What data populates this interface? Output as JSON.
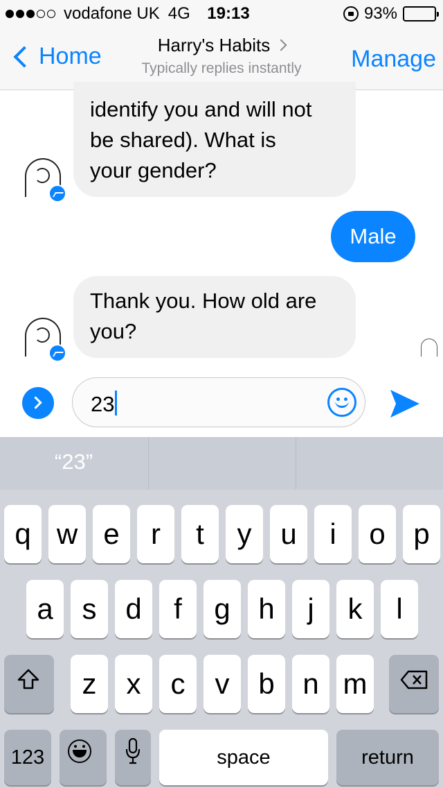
{
  "status_bar": {
    "carrier": "vodafone UK",
    "network": "4G",
    "time": "19:13",
    "battery": "93%",
    "battery_level": 0.93,
    "signal_bars_filled": 3,
    "signal_bars_total": 5
  },
  "nav": {
    "back_label": "Home",
    "title": "Harry's Habits",
    "subtitle": "Typically replies instantly",
    "manage_label": "Manage"
  },
  "messages": [
    {
      "from": "bot",
      "lines": [
        "identify you and will not",
        "be shared). What is",
        "your gender?"
      ]
    },
    {
      "from": "user",
      "text": "Male"
    },
    {
      "from": "bot",
      "lines": [
        "Thank you. How old are",
        "you?"
      ]
    }
  ],
  "composer": {
    "value": "23"
  },
  "keyboard": {
    "suggestions": [
      "“23”",
      "",
      ""
    ],
    "row1": [
      "q",
      "w",
      "e",
      "r",
      "t",
      "y",
      "u",
      "i",
      "o",
      "p"
    ],
    "row2": [
      "a",
      "s",
      "d",
      "f",
      "g",
      "h",
      "j",
      "k",
      "l"
    ],
    "row3": [
      "z",
      "x",
      "c",
      "v",
      "b",
      "n",
      "m"
    ],
    "numbers_label": "123",
    "space_label": "space",
    "return_label": "return"
  },
  "colors": {
    "accent": "#0a84ff",
    "bubble_incoming": "#f1f0f0",
    "keyboard_bg": "#d1d5db"
  }
}
